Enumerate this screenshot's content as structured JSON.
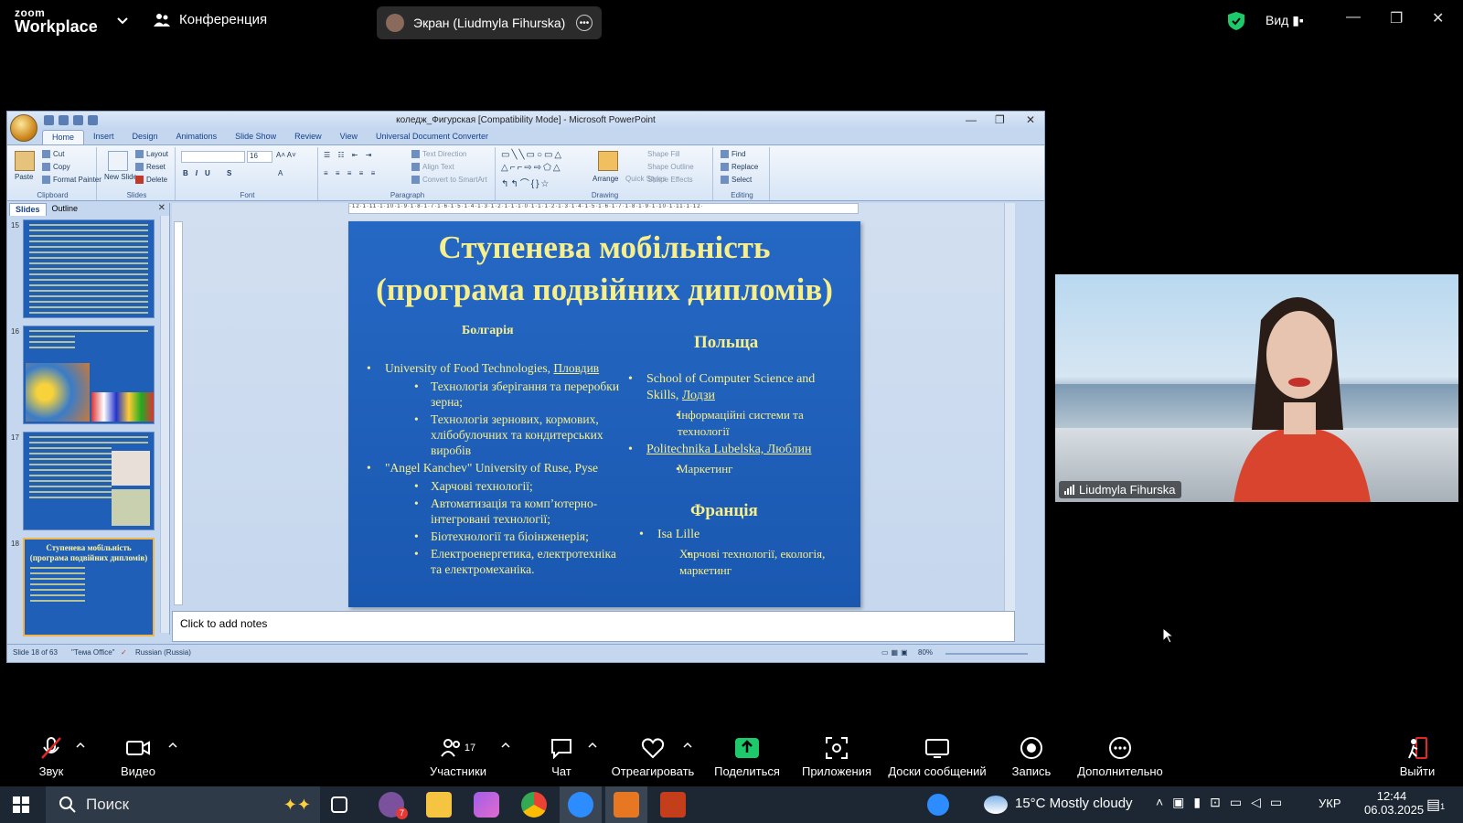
{
  "zoom": {
    "logo_top": "zoom",
    "logo_bottom": "Workplace",
    "conference_label": "Конференция",
    "share_label": "Экран (Liudmyla Fihurska)",
    "view_label": "Вид",
    "participant_count": "17",
    "toolbar": {
      "audio": "Звук",
      "video": "Видео",
      "participants": "Участники",
      "chat": "Чат",
      "react": "Отреагировать",
      "share": "Поделиться",
      "apps": "Приложения",
      "whiteboards": "Доски сообщений",
      "record": "Запись",
      "more": "Дополнительно",
      "leave": "Выйти"
    },
    "video_name": "Liudmyla Fihurska",
    "accent_green": "#1ec96b"
  },
  "ppt": {
    "title": "коледж_Фигурская [Compatibility Mode] - Microsoft PowerPoint",
    "tabs": [
      "Home",
      "Insert",
      "Design",
      "Animations",
      "Slide Show",
      "Review",
      "View",
      "Universal Document Converter"
    ],
    "ribbon": {
      "clipboard": {
        "name": "Clipboard",
        "paste": "Paste",
        "cut": "Cut",
        "copy": "Copy",
        "format_painter": "Format Painter"
      },
      "slides": {
        "name": "Slides",
        "new_slide": "New Slide",
        "layout": "Layout",
        "reset": "Reset",
        "delete": "Delete"
      },
      "font": {
        "name": "Font",
        "size": "16"
      },
      "paragraph": {
        "name": "Paragraph",
        "text_direction": "Text Direction",
        "align_text": "Align Text",
        "convert": "Convert to SmartArt"
      },
      "drawing": {
        "name": "Drawing",
        "arrange": "Arrange",
        "quick_styles": "Quick Styles",
        "shape_fill": "Shape Fill",
        "shape_outline": "Shape Outline",
        "shape_effects": "Shape Effects"
      },
      "editing": {
        "name": "Editing",
        "find": "Find",
        "replace": "Replace",
        "select": "Select"
      }
    },
    "pane_tabs": {
      "slides": "Slides",
      "outline": "Outline"
    },
    "thumbnails": [
      {
        "num": "15"
      },
      {
        "num": "16"
      },
      {
        "num": "17"
      },
      {
        "num": "18",
        "title": "Ступенева мобільність (програма подвійних дипломів)"
      }
    ],
    "ruler_text": "·12·1·11·1·10·1·9·1·8·1·7·1·6·1·5·1·4·1·3·1·2·1·1·1·0·1·1·1·2·1·3·1·4·1·5·1·6·1·7·1·8·1·9·1·10·1·11·1·12·",
    "slide": {
      "title_line1": "Ступенева мобільність",
      "title_line2": "(програма подвійних дипломів)",
      "left_heading": "Болгарія",
      "left_items": [
        {
          "text_a": "University of Food Technologies, ",
          "text_b": "Пловдив"
        },
        {
          "sub": "Технологія зберігання та переробки зерна;"
        },
        {
          "sub": "Технологія зернових, кормових, хлібобулочних та кондитерських виробів"
        },
        {
          "text_a": "\"Angel Kanchev\" University of Ruse, Руse",
          "text_b": ""
        },
        {
          "sub": "Харчові технології;"
        },
        {
          "sub": "Автоматизація та комп’ютерно-інтегровані технології;"
        },
        {
          "sub": "Біотехнології та біоінженерія;"
        },
        {
          "sub": "Електроенергетика, електротехніка та електромеханіка."
        }
      ],
      "right_heading1": "Польща",
      "right_items1": [
        {
          "text_a": "School of Computer Science and Skills, ",
          "text_b": "Лодзи"
        },
        {
          "sub": "Інформаційні системи та технології"
        },
        {
          "text_a": "",
          "text_b": "Politechnika Lubelska, Люблин"
        },
        {
          "sub": "Маркетинг"
        }
      ],
      "right_heading2": "Франція",
      "right_items2": [
        {
          "text_a": "Isa Lille"
        },
        {
          "sub": "Харчові технології, екологія, маркетинг"
        }
      ]
    },
    "notes_placeholder": "Click to add notes",
    "status": {
      "slide": "Slide 18 of 63",
      "theme": "\"Тема Office\"",
      "language": "Russian (Russia)",
      "zoom": "80%"
    }
  },
  "taskbar": {
    "search_placeholder": "Поиск",
    "weather": "15°C  Mostly cloudy",
    "language": "УКР",
    "time": "12:44",
    "date": "06.03.2025",
    "viber_badge": "7",
    "notif_badge": "1"
  }
}
